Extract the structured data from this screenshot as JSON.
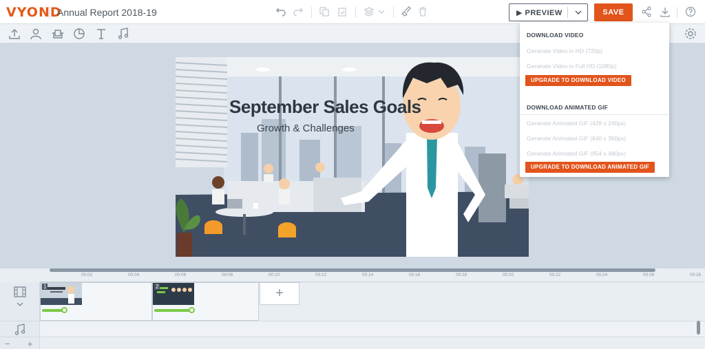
{
  "app": {
    "logo": "VYOND",
    "project_title": "Annual Report 2018-19"
  },
  "header": {
    "preview_label": "▶  PREVIEW",
    "save_label": "SAVE"
  },
  "scene": {
    "title": "September Sales Goals",
    "subtitle": "Growth & Challenges"
  },
  "download_menu": {
    "video_heading": "DOWNLOAD VIDEO",
    "video_items": [
      "Generate Video in HD (720p)",
      "Generate Video in Full HD (1080p)"
    ],
    "video_upgrade": "UPGRADE TO DOWNLOAD VIDEO",
    "gif_heading": "DOWNLOAD ANIMATED GIF",
    "gif_items": [
      "Generate Animated GIF (428 x 240px)",
      "Generate Animated GIF (640 x 360px)",
      "Generate Animated GIF (854 x 480px)"
    ],
    "gif_upgrade": "UPGRADE TO DOWNLOAD ANIMATED GIF"
  },
  "timeline": {
    "ticks": [
      "00:02",
      "00:04",
      "00:06",
      "00:08",
      "00:10",
      "00:12",
      "00:14",
      "00:16",
      "00:18",
      "00:20",
      "00:22",
      "00:24",
      "00:26",
      "00:28"
    ],
    "scenes": [
      {
        "number": "1"
      },
      {
        "number": "2"
      }
    ],
    "add_label": "+"
  },
  "colors": {
    "brand": "#e2541c",
    "accent_green": "#7ac943"
  }
}
